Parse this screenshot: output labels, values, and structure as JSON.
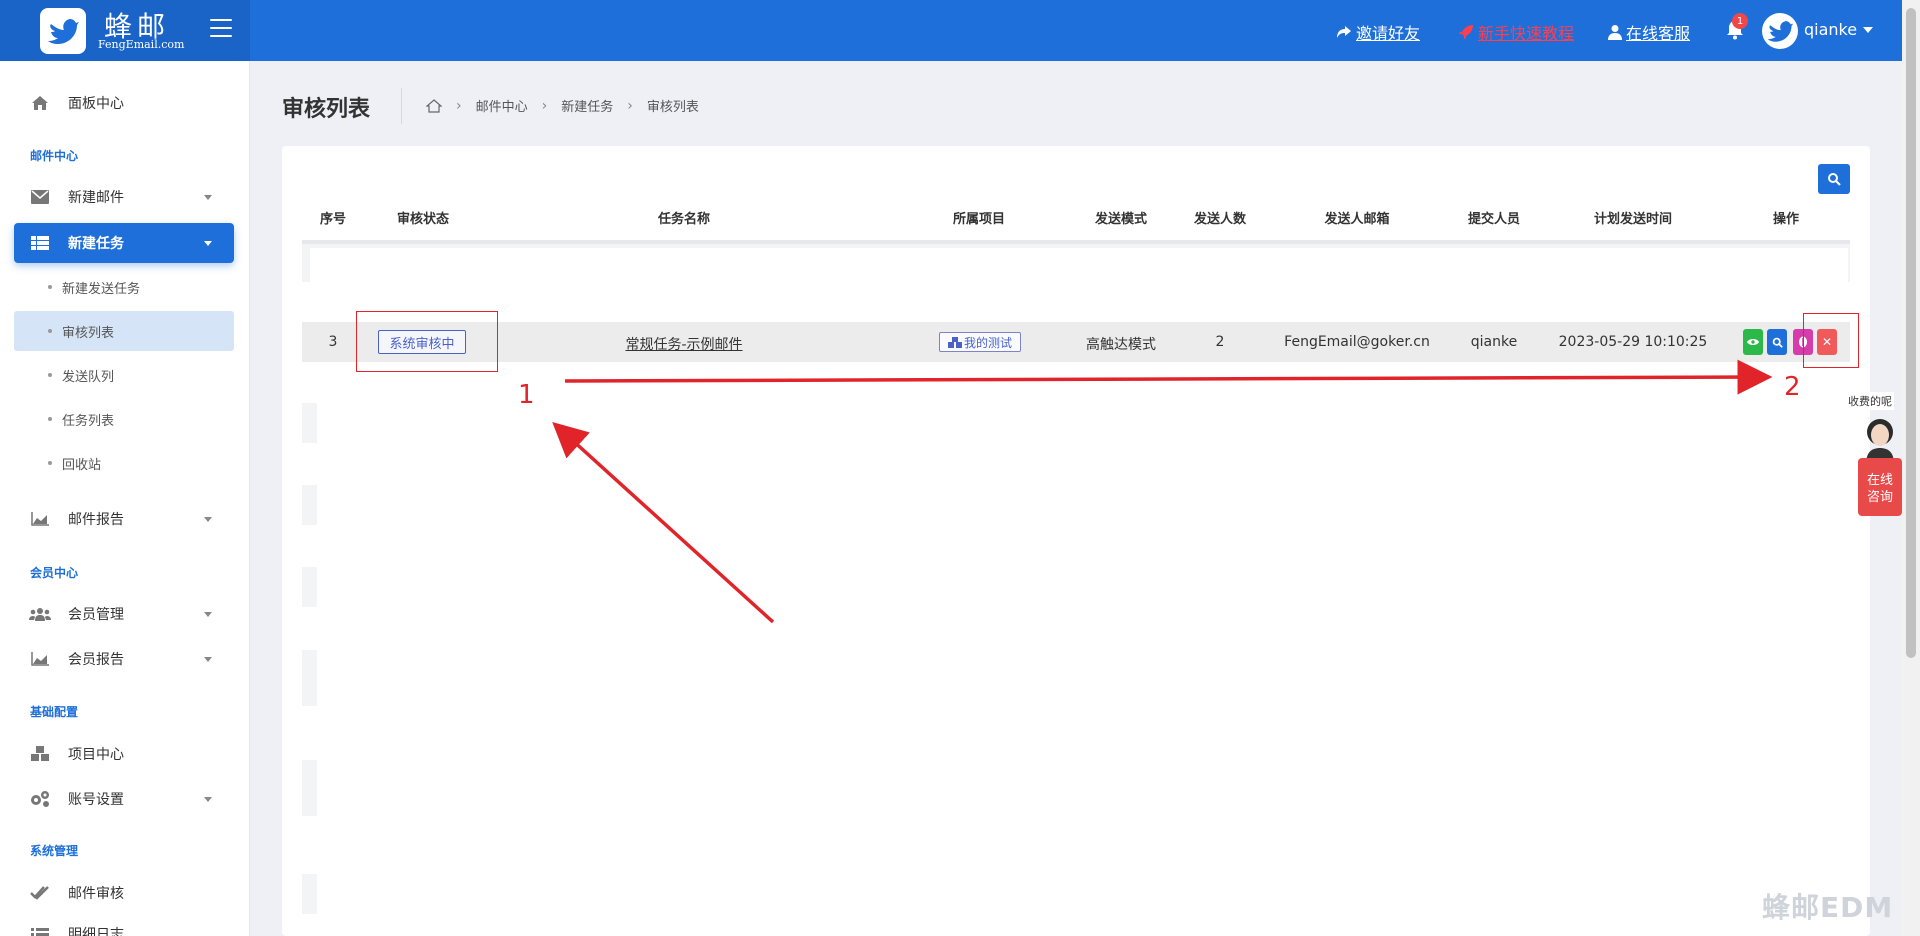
{
  "brand": {
    "name_cn": "蜂邮",
    "name_en": "FengEmail.com"
  },
  "header": {
    "links": [
      {
        "label": "邀请好友",
        "icon": "share-icon"
      },
      {
        "label": "新手快速教程",
        "icon": "rocket-icon"
      },
      {
        "label": "在线客服",
        "icon": "user-icon"
      }
    ],
    "notification_count": "1",
    "username": "qianke"
  },
  "sidebar": {
    "dashboard": "面板中心",
    "sections": {
      "mail_center": "邮件中心",
      "member_center": "会员中心",
      "basic_config": "基础配置",
      "system_admin": "系统管理"
    },
    "items": {
      "new_mail": "新建邮件",
      "new_task": "新建任务",
      "sub_new_send_task": "新建发送任务",
      "sub_review_list": "审核列表",
      "sub_send_queue": "发送队列",
      "sub_task_list": "任务列表",
      "sub_recycle": "回收站",
      "mail_report": "邮件报告",
      "member_manage": "会员管理",
      "member_report": "会员报告",
      "project_center": "项目中心",
      "account_settings": "账号设置",
      "mail_review": "邮件审核",
      "detail_log": "明细日志"
    }
  },
  "page": {
    "title": "审核列表",
    "breadcrumb": [
      "邮件中心",
      "新建任务",
      "审核列表"
    ]
  },
  "table": {
    "columns": [
      "序号",
      "审核状态",
      "任务名称",
      "所属项目",
      "发送模式",
      "发送人数",
      "发送人邮箱",
      "提交人员",
      "计划发送时间",
      "操作"
    ],
    "rows": [
      {
        "index": "3",
        "status": "系统审核中",
        "task_name": "常规任务-示例邮件",
        "project": "我的测试",
        "send_mode": "高触达模式",
        "recipients": "2",
        "sender_email": "FengEmail@goker.cn",
        "submitter": "qianke",
        "scheduled_time": "2023-05-29 10:10:25",
        "actions": [
          "view",
          "search",
          "pay",
          "delete"
        ]
      }
    ]
  },
  "annotations": {
    "marker1": "1",
    "marker2": "2"
  },
  "consult": {
    "note": "收费的呢",
    "button": "在线\n咨询"
  },
  "watermark": "蜂邮EDM",
  "colors": {
    "primary": "#1e6fd9",
    "annotation": "#e0242a",
    "success": "#2db84a",
    "danger": "#f05a5a",
    "pink": "#d63caa"
  }
}
